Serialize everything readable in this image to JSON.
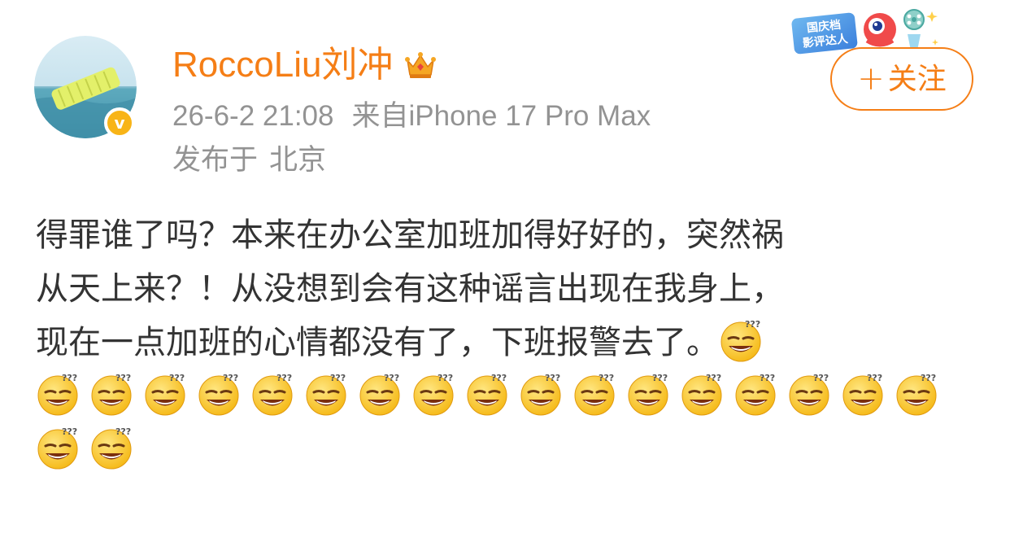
{
  "user": {
    "name": "RoccoLiu刘冲",
    "verified_mark": "v",
    "crown_icon": "crown-icon"
  },
  "meta": {
    "time": "26-6-2 21:08",
    "source": "来自iPhone 17 Pro Max",
    "location_prefix": "发布于",
    "location": "北京"
  },
  "event_badge": {
    "line1": "国庆档",
    "line2": "影评达人"
  },
  "follow_button": {
    "plus": "+",
    "label": "关注"
  },
  "post": {
    "lines": [
      "得罪谁了吗？本来在办公室加班加得好好的，突然祸",
      "从天上来？！从没想到会有这种谣言出现在我身上，",
      "现在一点加班的心情都没有了，下班报警去了。"
    ],
    "emoji_name": "doge-question-emoji",
    "emoji_count": 20
  },
  "colors": {
    "accent": "#f57e16",
    "meta_text": "#939393",
    "body_text": "#333333",
    "verified": "#f8b417"
  }
}
